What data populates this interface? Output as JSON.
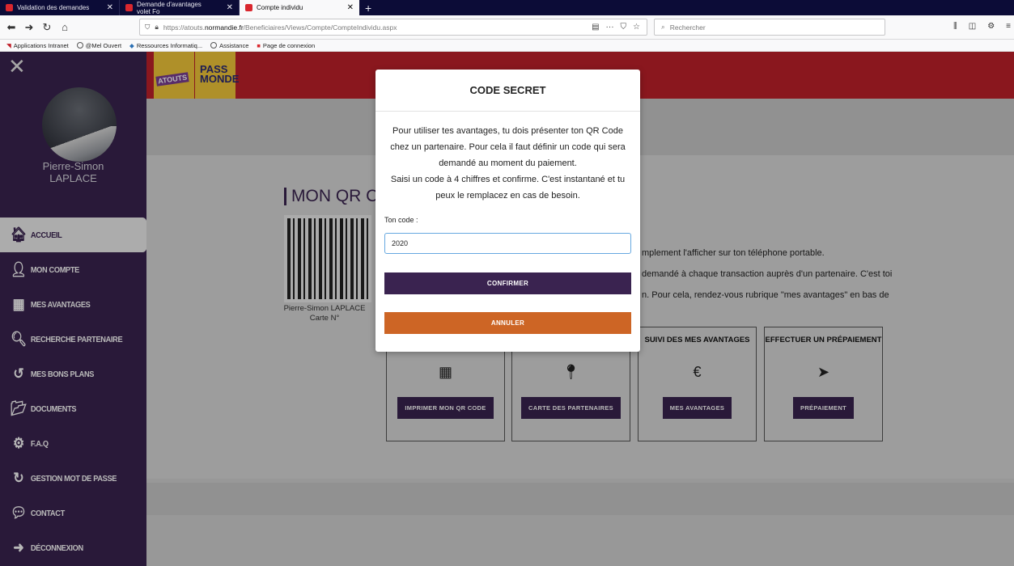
{
  "browser": {
    "tabs": [
      {
        "title": "Validation des demandes",
        "active": false
      },
      {
        "title": "Demande d'avantages volet Fo",
        "active": false
      },
      {
        "title": "Compte individu",
        "active": true
      }
    ],
    "url_prefix": "https://atouts.",
    "url_host": "normandie.fr",
    "url_path": "/Beneficiaires/Views/Compte/CompteIndividu.aspx",
    "search_placeholder": "Rechercher",
    "bookmarks": [
      "Applications Intranet",
      "@Mel Ouvert",
      "Ressources Informatiq...",
      "Assistance",
      "Page de connexion"
    ]
  },
  "sidebar": {
    "user_first": "Pierre-Simon",
    "user_last": "LAPLACE",
    "items": [
      {
        "label": "ACCUEIL",
        "icon": "home-icon",
        "active": true
      },
      {
        "label": "MON COMPTE",
        "icon": "user-icon",
        "active": false
      },
      {
        "label": "MES AVANTAGES",
        "icon": "qr-icon",
        "active": false
      },
      {
        "label": "RECHERCHE PARTENAIRE",
        "icon": "search-icon",
        "active": false
      },
      {
        "label": "MES BONS PLANS",
        "icon": "history-icon",
        "active": false
      },
      {
        "label": "DOCUMENTS",
        "icon": "folder-icon",
        "active": false
      },
      {
        "label": "F.A.Q",
        "icon": "gears-icon",
        "active": false
      },
      {
        "label": "GESTION MOT DE PASSE",
        "icon": "refresh-icon",
        "active": false
      },
      {
        "label": "CONTACT",
        "icon": "chat-icon",
        "active": false
      },
      {
        "label": "DÉCONNEXION",
        "icon": "logout-icon",
        "active": false
      }
    ]
  },
  "banner": {
    "logo1": "ATOUTS",
    "logo2": "PASS MONDE"
  },
  "page": {
    "qr_title": "MON QR COD",
    "qr_owner": "Pierre-Simon LAPLACE",
    "qr_card": "Carte N°",
    "info_lines": [
      "mplement l'afficher sur ton téléphone portable.",
      "demandé à chaque transaction auprès d'un partenaire. C'est toi",
      "n. Pour cela, rendez-vous rubrique \"mes avantages\" en bas de"
    ],
    "cards": [
      {
        "header": "",
        "icon": "qr-icon",
        "button": "IMPRIMER MON QR CODE"
      },
      {
        "header": "",
        "icon": "map-pin-icon",
        "button": "CARTE DES PARTENAIRES"
      },
      {
        "header": "SUIVI DES MES AVANTAGES",
        "icon": "euro-icon",
        "button": "MES AVANTAGES"
      },
      {
        "header": "EFFECTUER UN PRÉPAIEMENT",
        "icon": "paper-plane-icon",
        "button": "PRÉPAIEMENT"
      }
    ]
  },
  "modal": {
    "title": "CODE SECRET",
    "text1": "Pour utiliser tes avantages, tu dois présenter ton QR Code chez un partenaire. Pour cela il faut définir un code qui sera demandé au moment du paiement.",
    "text2": "Saisi un code à 4 chiffres et confirme. C'est instantané et tu peux le remplacez en cas de besoin.",
    "label": "Ton code :",
    "value": "2020",
    "confirm": "CONFIRMER",
    "cancel": "ANNULER"
  }
}
